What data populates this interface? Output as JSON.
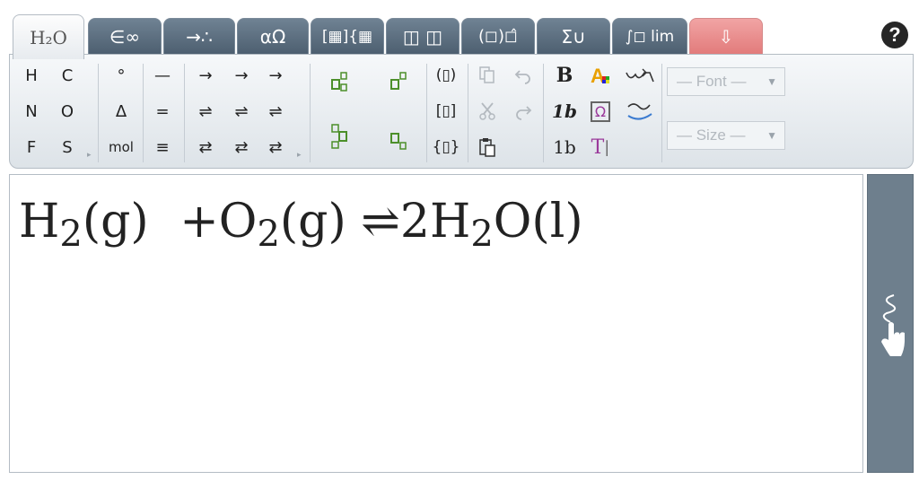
{
  "tabs": [
    {
      "id": "chem",
      "label": "H₂O",
      "active": true
    },
    {
      "id": "sets",
      "label": "∈∞"
    },
    {
      "id": "arrows",
      "label": "→∴"
    },
    {
      "id": "greek",
      "label": "αΩ"
    },
    {
      "id": "matrix",
      "label": "[▦]{▦"
    },
    {
      "id": "script",
      "label": "◫ ◫"
    },
    {
      "id": "brackets",
      "label": "(◻)◻̂"
    },
    {
      "id": "sum",
      "label": "Σ∪"
    },
    {
      "id": "integrals",
      "label": "∫◻ lim"
    },
    {
      "id": "special",
      "label": "⇩"
    }
  ],
  "help": {
    "label": "?"
  },
  "toolbar": {
    "elements": [
      "H",
      "C",
      "N",
      "O",
      "F",
      "S"
    ],
    "degree": "°",
    "delta": "Δ",
    "mol": "mol",
    "bonds": [
      "—",
      "=",
      "≡"
    ],
    "arrows": [
      "→",
      "→",
      "→",
      "⇌",
      "⇌",
      "⇌",
      "⇄",
      "⇄",
      "⇄"
    ],
    "brackets": [
      "(▯)",
      "[▯]",
      "{▯}"
    ],
    "bold": "B",
    "italic_1b": "1b",
    "plain_1b": "1b",
    "omega_box": "Ω",
    "text_tool": "T",
    "font_select": "— Font —",
    "size_select": "— Size —"
  },
  "editor": {
    "equation": {
      "h2_sym": "H",
      "h2_sub": "2",
      "state1": "(g)",
      "plus": "+",
      "o2_sym": "O",
      "o2_sub": "2",
      "state2": "(g)",
      "arrow": "⇌",
      "coeff": "2",
      "h2o_h": "H",
      "h2o_sub": "2",
      "h2o_o": "O",
      "state3": "(l)"
    }
  },
  "colors": {
    "tab": "#5d6f80",
    "accent": "#4c8f2a",
    "special_tab": "#e88c8c",
    "sidebar": "#6e7f8d"
  }
}
